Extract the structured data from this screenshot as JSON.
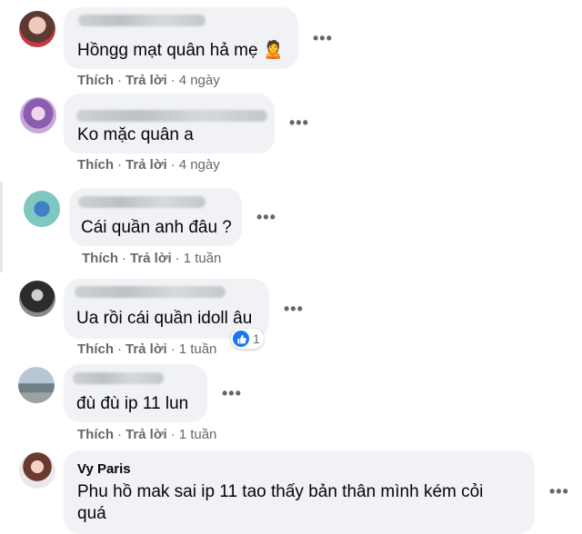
{
  "comments": [
    {
      "text": "Hồngg mạt quân hả mẹ",
      "emoji": "🙎",
      "like": "Thích",
      "reply": "Trả lời",
      "time": "4 ngày",
      "more": "•••"
    },
    {
      "text": "Ko mặc quân a",
      "like": "Thích",
      "reply": "Trả lời",
      "time": "4 ngày",
      "more": "•••"
    },
    {
      "text": "Cái quần anh đâu ?",
      "like": "Thích",
      "reply": "Trả lời",
      "time": "1 tuần",
      "more": "•••"
    },
    {
      "text": "Ua rồi cái quần idoll âu",
      "like": "Thích",
      "reply": "Trả lời",
      "time": "1 tuần",
      "more": "•••",
      "reaction_count": "1"
    },
    {
      "text": "đù đù ip 11 lun",
      "like": "Thích",
      "reply": "Trả lời",
      "time": "1 tuần",
      "more": "•••"
    },
    {
      "name": "Vy Paris",
      "text": "Phu hồ mak sai ip 11 tao thấy bản thân mình kém cỏi quá",
      "more": "•••"
    }
  ],
  "colors": {
    "bubble": "#f0f2f5",
    "meta": "#65676b",
    "like_blue": "#1877f2"
  }
}
